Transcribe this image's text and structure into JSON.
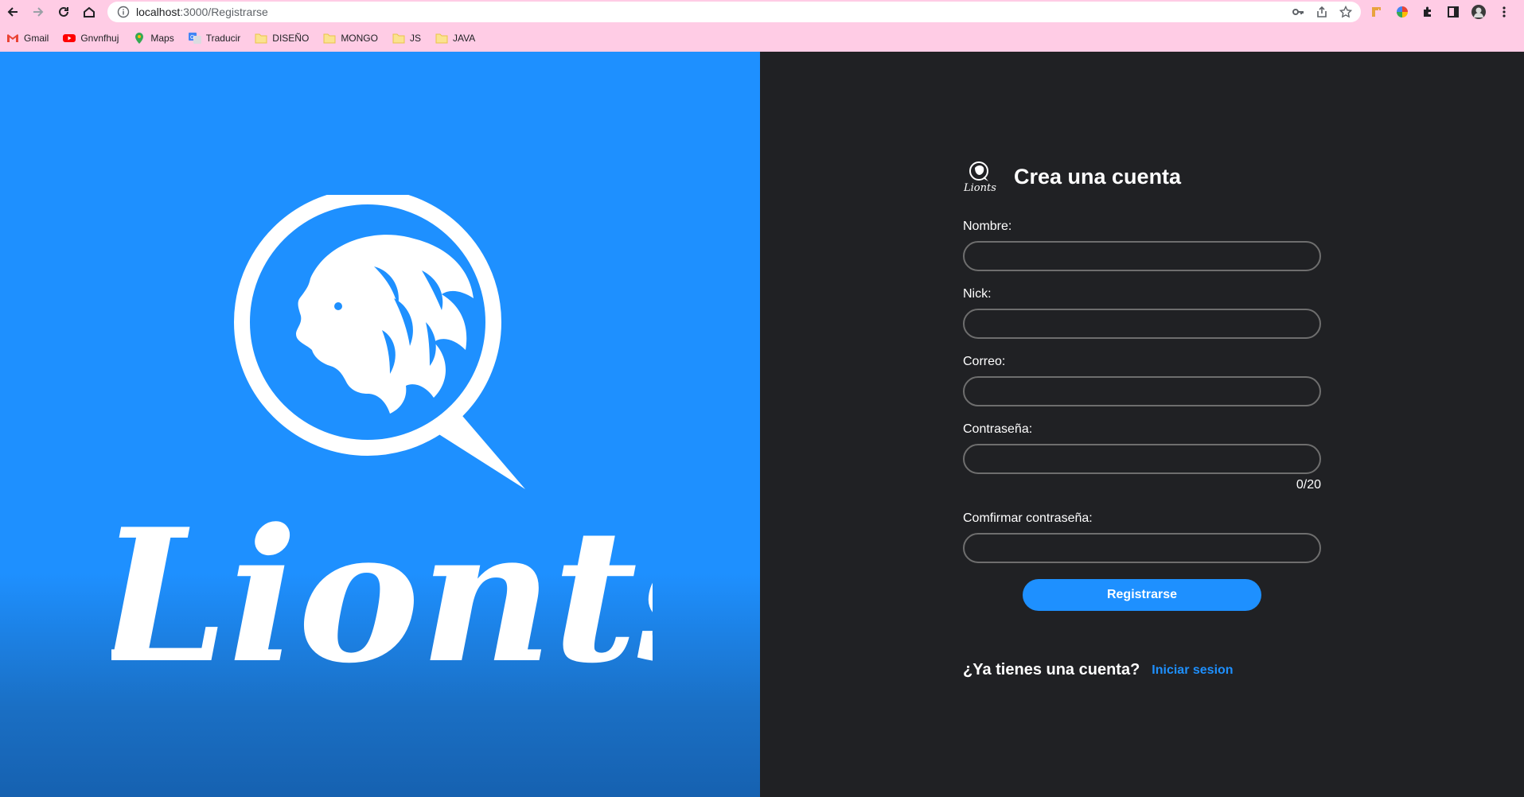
{
  "browser": {
    "url_host": "localhost",
    "url_path": ":3000/Registrarse",
    "bookmarks": [
      {
        "label": "Gmail",
        "icon": "gmail-icon"
      },
      {
        "label": "Gnvnfhuj",
        "icon": "youtube-icon"
      },
      {
        "label": "Maps",
        "icon": "maps-icon"
      },
      {
        "label": "Traducir",
        "icon": "translate-icon"
      },
      {
        "label": "DISEÑO",
        "icon": "folder-icon"
      },
      {
        "label": "MONGO",
        "icon": "folder-icon"
      },
      {
        "label": "JS",
        "icon": "folder-icon"
      },
      {
        "label": "JAVA",
        "icon": "folder-icon"
      }
    ]
  },
  "brand": {
    "logo_text": "Lionts",
    "primary_color": "#1e90ff",
    "dark_color": "#202124"
  },
  "form": {
    "title": "Crea una cuenta",
    "fields": [
      {
        "label": "Nombre:",
        "value": ""
      },
      {
        "label": "Nick:",
        "value": ""
      },
      {
        "label": "Correo:",
        "value": ""
      },
      {
        "label": "Contraseña:",
        "value": "",
        "counter": "0/20"
      },
      {
        "label": "Comfirmar contraseña:",
        "value": ""
      }
    ],
    "submit_label": "Registrarse",
    "already_text": "¿Ya tienes una cuenta?",
    "login_link": "Iniciar sesion"
  }
}
